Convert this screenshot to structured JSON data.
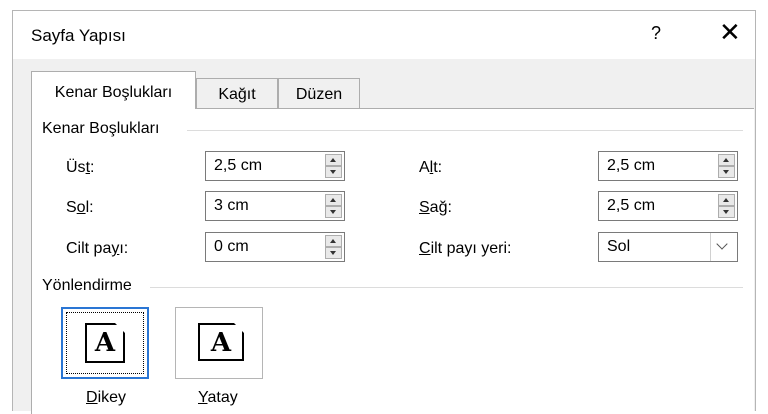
{
  "window": {
    "title": "Sayfa Yapısı",
    "help_label": "?",
    "close_label": "✕"
  },
  "tabs": [
    {
      "label": "Kenar Boşlukları",
      "active": true
    },
    {
      "label": "Kağıt",
      "active": false
    },
    {
      "label": "Düzen",
      "active": false
    }
  ],
  "margins": {
    "section_label": "Kenar Boşlukları",
    "top": {
      "prefix": "Üs",
      "accel": "t",
      "suffix": ":",
      "value": "2,5 cm"
    },
    "left": {
      "prefix": "S",
      "accel": "o",
      "suffix": "l:",
      "value": "3 cm"
    },
    "gutter": {
      "prefix": "Cilt pa",
      "accel": "y",
      "suffix": "ı:",
      "value": "0 cm"
    },
    "bottom": {
      "prefix": "A",
      "accel": "l",
      "suffix": "t:",
      "value": "2,5 cm"
    },
    "right": {
      "prefix": "",
      "accel": "S",
      "suffix": "ağ:",
      "value": "2,5 cm"
    },
    "gutter_position": {
      "prefix": "",
      "accel": "C",
      "suffix": "ilt payı yeri:",
      "value": "Sol"
    }
  },
  "orientation": {
    "section_label": "Yönlendirme",
    "portrait": {
      "accel": "D",
      "rest": "ikey",
      "icon_letter": "A",
      "selected": true
    },
    "landscape": {
      "accel": "Y",
      "rest": "atay",
      "icon_letter": "A",
      "selected": false
    }
  }
}
